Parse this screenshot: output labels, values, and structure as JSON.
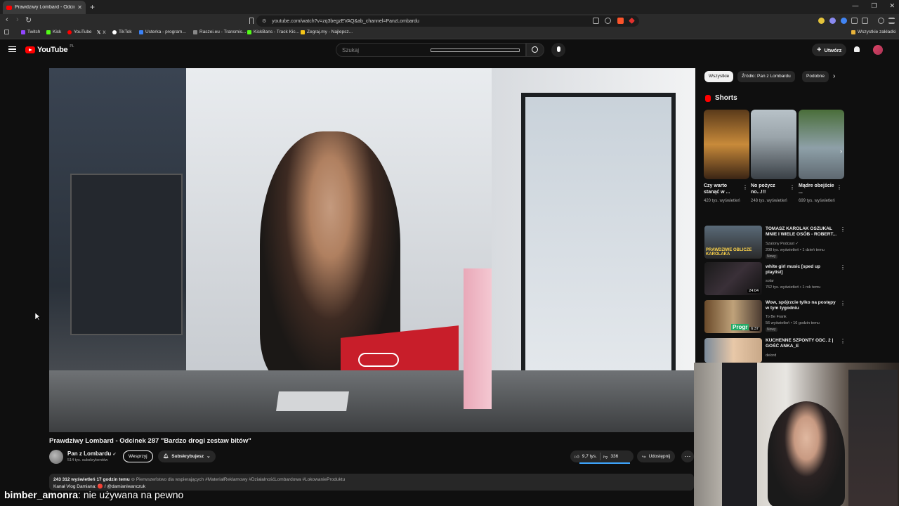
{
  "browser": {
    "tab_title": "Prawdziwy Lombard - Odcinek",
    "url": "youtube.com/watch?v=zq3begzEVAQ&ab_channel=PanzLombardu",
    "bookmarks": [
      "Twitch",
      "Kick",
      "YouTube",
      "X",
      "TikTok",
      "Usterka - program...",
      "Raszei.eu - Transmis...",
      "KickBans - Track Kic...",
      "Zegraj.my - Najlepsz..."
    ],
    "bookmarks_all": "Wszystkie zakładki",
    "icons": [
      "back-icon",
      "forward-icon",
      "reload-icon",
      "apps-icon",
      "bookmark-icon",
      "extensions-icon"
    ]
  },
  "youtube": {
    "logo_text": "YouTube",
    "logo_region": "PL",
    "search_placeholder": "Szukaj",
    "create_label": "Utwórz"
  },
  "video": {
    "title": "Prawdziwy Lombard - Odcinek 287 \"Bardzo drogi zestaw bitów\"",
    "channel": "Pan z Lombardu",
    "subscribers": "514 tys. subskrybentów",
    "support_label": "Wesprzyj",
    "subscribed_label": "Subskrybujesz",
    "likes": "9,7 tys.",
    "dislikes": "336",
    "share_label": "Udostępnij",
    "views": "243 312 wyświetleń",
    "age": "17 godzin temu",
    "desc_tags": "⊖ Pierwszeństwo dla wspierających #MateriałReklamowy #DziałalnośćLombardowa #LokowanieProduktu",
    "desc_line2": "Kanał Vlog Damiana: 🔴 / @damianiwanczuk",
    "like_fraction": 0.97
  },
  "sidebar": {
    "chips": [
      "Wszystkie",
      "Źródło: Pan z Lombardu",
      "Podobne"
    ],
    "shorts_heading": "Shorts",
    "shorts": [
      {
        "title": "Czy warto stanąć w ...",
        "views": "420 tys. wyświetleń"
      },
      {
        "title": "No pożycz no...!!!",
        "views": "248 tys. wyświetleń"
      },
      {
        "title": "Mądre obejście ...",
        "views": "699 tys. wyświetleń"
      }
    ],
    "recommendations": [
      {
        "title": "TOMASZ KAROLAK OSZUKAŁ MNIE I WIELE OSÓB - ROBERT...",
        "channel": "Szalony Podcast ✓",
        "meta": "208 tys. wyświetleń • 1 dzień temu",
        "badge": "Nowy",
        "thumb_text": "PRAWDZIWE OBLICZE KAROLAKA",
        "duration": ""
      },
      {
        "title": "white girl music [sped up playlist]",
        "channel": "solar",
        "meta": "762 tys. wyświetleń • 1 rok temu",
        "badge": "",
        "thumb_text": "",
        "duration": "24:04"
      },
      {
        "title": "Wow, spójrzcie tylko na postępy w tym tygodniu",
        "channel": "To Be Frank",
        "meta": "56 wyświetleń • 16 godzin temu",
        "badge": "Nowy",
        "thumb_text": "Progr",
        "duration": "6:37"
      },
      {
        "title": "KUCHENNE SZPONTY ODC. 2 | GOŚĆ ANKA_E",
        "channel": "delord",
        "meta": "",
        "badge": "",
        "thumb_text": "",
        "duration": ""
      }
    ]
  },
  "chat": {
    "user": "bimber_amonra",
    "message": ": nie używana na pewno"
  }
}
